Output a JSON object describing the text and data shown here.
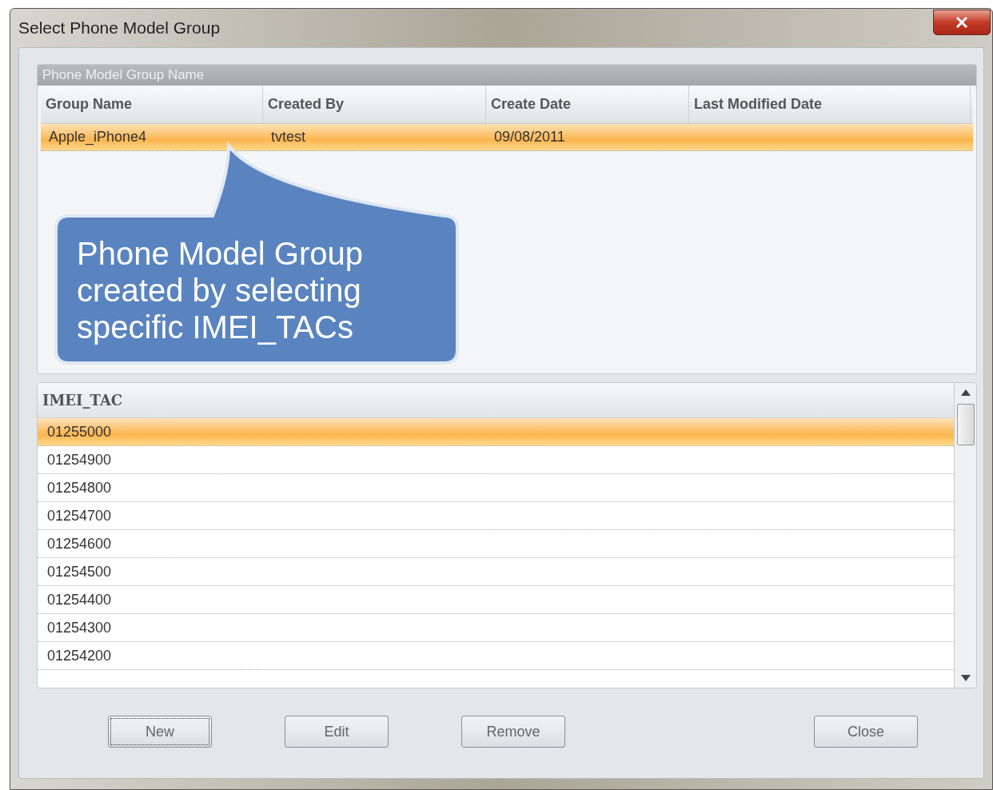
{
  "window": {
    "title": "Select Phone Model Group"
  },
  "group_panel": {
    "title": "Phone Model Group Name",
    "columns": [
      "Group Name",
      "Created By",
      "Create Date",
      "Last Modified Date"
    ],
    "rows": [
      {
        "cells": [
          "Apple_iPhone4",
          "tvtest",
          "09/08/2011",
          ""
        ],
        "selected": true
      }
    ]
  },
  "callout": {
    "text": "Phone Model Group created by selecting specific IMEI_TACs"
  },
  "imei_list": {
    "header": "IMEI_TAC",
    "rows": [
      {
        "value": "01255000",
        "selected": true
      },
      {
        "value": "01254900",
        "selected": false
      },
      {
        "value": "01254800",
        "selected": false
      },
      {
        "value": "01254700",
        "selected": false
      },
      {
        "value": "01254600",
        "selected": false
      },
      {
        "value": "01254500",
        "selected": false
      },
      {
        "value": "01254400",
        "selected": false
      },
      {
        "value": "01254300",
        "selected": false
      },
      {
        "value": "01254200",
        "selected": false
      }
    ]
  },
  "buttons": [
    {
      "label": "New",
      "focused": true
    },
    {
      "label": "Edit",
      "focused": false
    },
    {
      "label": "Remove",
      "focused": false
    },
    {
      "label": "Close",
      "focused": false
    }
  ]
}
